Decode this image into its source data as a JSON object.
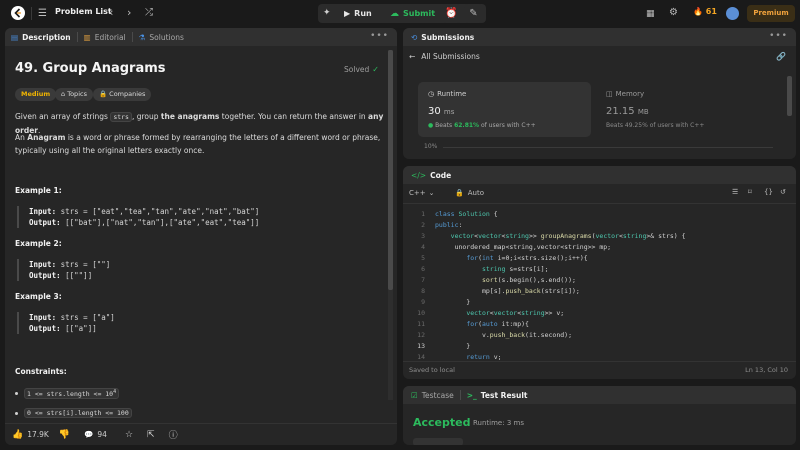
{
  "topbar": {
    "problem_list": "Problem List",
    "run": "Run",
    "submit": "Submit",
    "streak": "61",
    "premium": "Premium"
  },
  "left": {
    "tabs": [
      "Description",
      "Editorial",
      "Solutions"
    ],
    "title": "49. Group Anagrams",
    "solved": "Solved",
    "tags": [
      "Medium",
      "Topics",
      "Companies"
    ],
    "desc1_a": "Given an array of strings ",
    "desc1_code": "strs",
    "desc1_b": ", group ",
    "desc1_bold1": "the anagrams",
    "desc1_c": " together. You can return the answer in ",
    "desc1_bold2": "any order",
    "desc1_d": ".",
    "desc2_bold": "Anagram",
    "desc2_rest": " is a word or phrase formed by rearranging the letters of a different word or phrase, typically using all the original letters exactly once.",
    "desc2_prefix": "An ",
    "examples": [
      {
        "title": "Example 1:",
        "input": "strs = [\"eat\",\"tea\",\"tan\",\"ate\",\"nat\",\"bat\"]",
        "output": "[[\"bat\"],[\"nat\",\"tan\"],[\"ate\",\"eat\",\"tea\"]]"
      },
      {
        "title": "Example 2:",
        "input": "strs = [\"\"]",
        "output": "[[\"\"]]"
      },
      {
        "title": "Example 3:",
        "input": "strs = [\"a\"]",
        "output": "[[\"a\"]]"
      }
    ],
    "input_label": "Input:",
    "output_label": "Output:",
    "constraints_title": "Constraints:",
    "constraint1": "1 <= strs.length <= 10",
    "constraint1_sup": "4",
    "constraint2": "0 <= strs[i].length <= 100",
    "likes": "17.9K",
    "comments": "94"
  },
  "subs": {
    "title": "Submissions",
    "back": "All Submissions",
    "runtime_label": "Runtime",
    "runtime_value": "30",
    "runtime_unit": "ms",
    "runtime_beats": "Beats",
    "runtime_pct": "62.81%",
    "runtime_suffix": "of users with C++",
    "memory_label": "Memory",
    "memory_value": "21.15",
    "memory_unit": "MB",
    "memory_beats": "Beats",
    "memory_pct": "49.25%",
    "memory_suffix": "of users with C++",
    "axis_label": "10%"
  },
  "code": {
    "title": "Code",
    "language": "C++",
    "auto": "Auto",
    "status_left": "Saved to local",
    "status_right": "Ln 13, Col 10"
  },
  "test": {
    "tab1": "Testcase",
    "tab2": "Test Result",
    "status": "Accepted",
    "runtime": "Runtime: 3 ms"
  }
}
